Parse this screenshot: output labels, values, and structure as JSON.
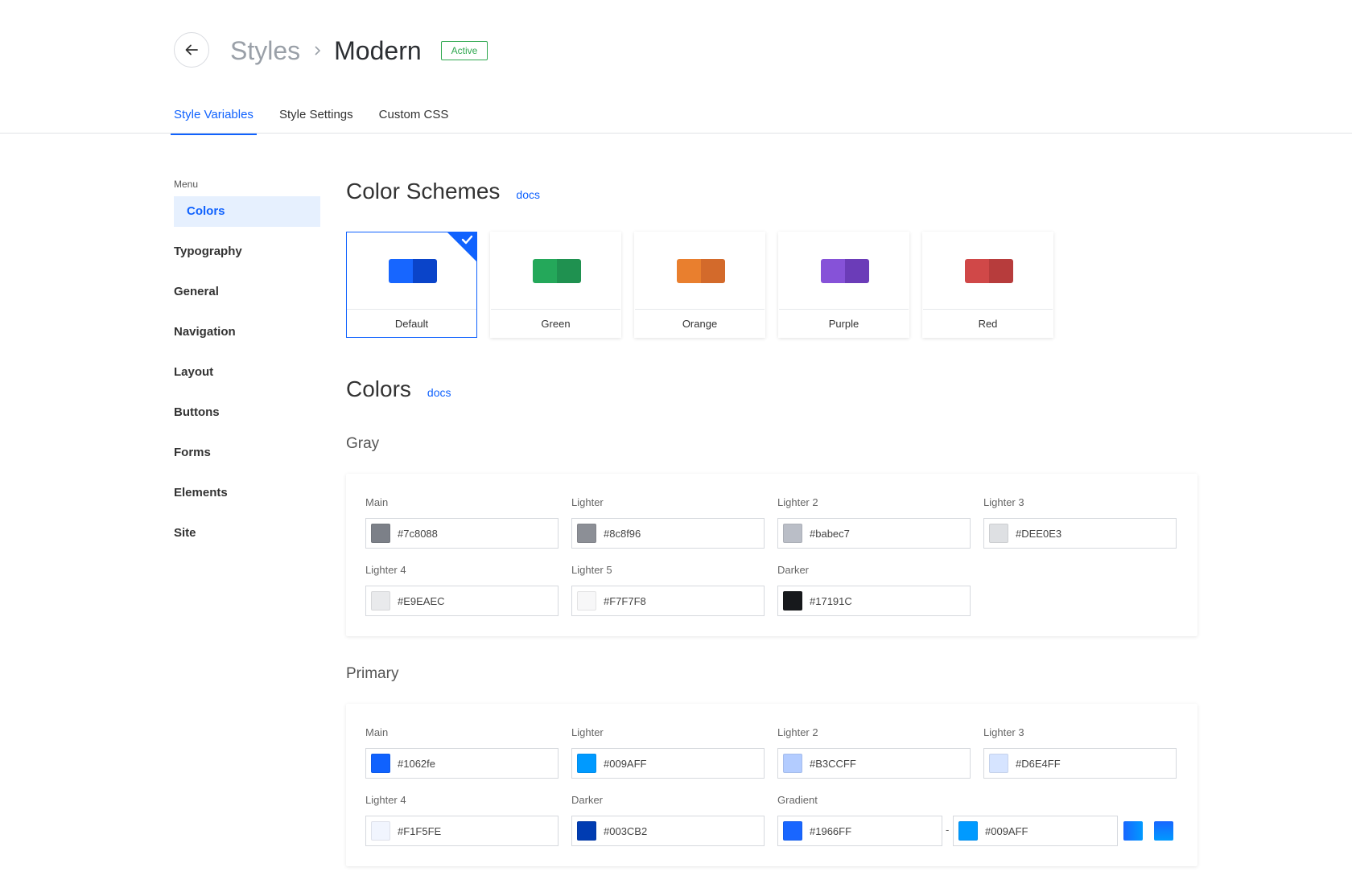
{
  "header": {
    "breadcrumb_parent": "Styles",
    "breadcrumb_current": "Modern",
    "status": "Active"
  },
  "tabs": [
    {
      "label": "Style Variables",
      "active": true
    },
    {
      "label": "Style Settings",
      "active": false
    },
    {
      "label": "Custom CSS",
      "active": false
    }
  ],
  "sidebar": {
    "title": "Menu",
    "items": [
      {
        "label": "Colors",
        "active": true
      },
      {
        "label": "Typography"
      },
      {
        "label": "General"
      },
      {
        "label": "Navigation"
      },
      {
        "label": "Layout"
      },
      {
        "label": "Buttons"
      },
      {
        "label": "Forms"
      },
      {
        "label": "Elements"
      },
      {
        "label": "Site"
      }
    ]
  },
  "color_schemes": {
    "title": "Color Schemes",
    "docs_label": "docs",
    "items": [
      {
        "label": "Default",
        "colors": [
          "#1766ff",
          "#0a44c9"
        ],
        "selected": true
      },
      {
        "label": "Green",
        "colors": [
          "#24a85a",
          "#1f9150"
        ]
      },
      {
        "label": "Orange",
        "colors": [
          "#e97f2e",
          "#d36a2b"
        ]
      },
      {
        "label": "Purple",
        "colors": [
          "#8652d8",
          "#6b3cb8"
        ]
      },
      {
        "label": "Red",
        "colors": [
          "#d04848",
          "#b73c3c"
        ]
      }
    ]
  },
  "colors": {
    "title": "Colors",
    "docs_label": "docs",
    "gray": {
      "title": "Gray",
      "fields": [
        {
          "label": "Main",
          "value": "#7c8088",
          "swatch": "#7c8088"
        },
        {
          "label": "Lighter",
          "value": "#8c8f96",
          "swatch": "#8c8f96"
        },
        {
          "label": "Lighter 2",
          "value": "#babec7",
          "swatch": "#babec7"
        },
        {
          "label": "Lighter 3",
          "value": "#DEE0E3",
          "swatch": "#DEE0E3"
        },
        {
          "label": "Lighter 4",
          "value": "#E9EAEC",
          "swatch": "#E9EAEC"
        },
        {
          "label": "Lighter 5",
          "value": "#F7F7F8",
          "swatch": "#F7F7F8"
        },
        {
          "label": "Darker",
          "value": "#17191C",
          "swatch": "#17191C"
        }
      ]
    },
    "primary": {
      "title": "Primary",
      "fields": [
        {
          "label": "Main",
          "value": "#1062fe",
          "swatch": "#1062fe"
        },
        {
          "label": "Lighter",
          "value": "#009AFF",
          "swatch": "#009AFF"
        },
        {
          "label": "Lighter 2",
          "value": "#B3CCFF",
          "swatch": "#B3CCFF"
        },
        {
          "label": "Lighter 3",
          "value": "#D6E4FF",
          "swatch": "#D6E4FF"
        },
        {
          "label": "Lighter 4",
          "value": "#F1F5FE",
          "swatch": "#F1F5FE"
        },
        {
          "label": "Darker",
          "value": "#003CB2",
          "swatch": "#003CB2"
        }
      ],
      "gradient": {
        "label": "Gradient",
        "start": "#1966FF",
        "end": "#009AFF",
        "separator": "-"
      }
    }
  },
  "accent_color": "#1062fe"
}
